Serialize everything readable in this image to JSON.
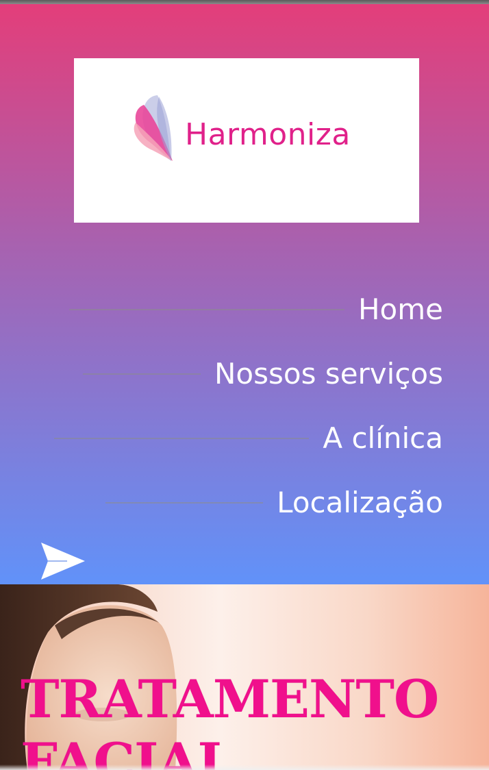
{
  "brand": {
    "name": "Harmoniza",
    "color": "#e0218a"
  },
  "nav": {
    "items": [
      {
        "label": "Home"
      },
      {
        "label": "Nossos serviços"
      },
      {
        "label": "A clínica"
      },
      {
        "label": "Localização"
      }
    ]
  },
  "actions": {
    "send_icon": "send-icon"
  },
  "hero": {
    "title": "TRATAMENTO FACIAL",
    "title_color": "#f0108c"
  },
  "colors": {
    "header_gradient_top": "#e33e7a",
    "header_gradient_bottom": "#6192f9"
  }
}
